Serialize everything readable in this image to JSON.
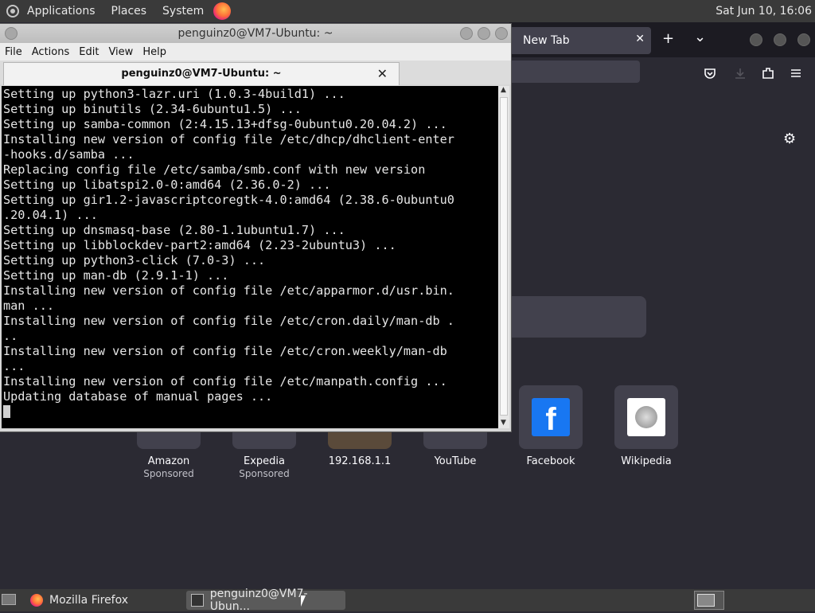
{
  "top_panel": {
    "menus": [
      "Applications",
      "Places",
      "System"
    ],
    "clock": "Sat Jun 10, 16:06"
  },
  "firefox": {
    "tab_label": "New Tab",
    "tab_close": "✕",
    "new_tab": "+",
    "tab_list": "⌄",
    "shortcuts": [
      {
        "title": "Amazon",
        "sub": "Sponsored"
      },
      {
        "title": "Expedia",
        "sub": "Sponsored"
      },
      {
        "title": "192.168.1.1",
        "sub": ""
      },
      {
        "title": "YouTube",
        "sub": ""
      },
      {
        "title": "Facebook",
        "sub": ""
      },
      {
        "title": "Wikipedia",
        "sub": ""
      }
    ]
  },
  "terminal": {
    "window_title": "penguinz0@VM7-Ubuntu: ~",
    "menu": [
      "File",
      "Actions",
      "Edit",
      "View",
      "Help"
    ],
    "tab_title": "penguinz0@VM7-Ubuntu: ~",
    "tab_close": "✕",
    "output": "Setting up python3-lazr.uri (1.0.3-4build1) ...\nSetting up binutils (2.34-6ubuntu1.5) ...\nSetting up samba-common (2:4.15.13+dfsg-0ubuntu0.20.04.2) ...\nInstalling new version of config file /etc/dhcp/dhclient-enter\n-hooks.d/samba ...\nReplacing config file /etc/samba/smb.conf with new version\nSetting up libatspi2.0-0:amd64 (2.36.0-2) ...\nSetting up gir1.2-javascriptcoregtk-4.0:amd64 (2.38.6-0ubuntu0\n.20.04.1) ...\nSetting up dnsmasq-base (2.80-1.1ubuntu1.7) ...\nSetting up libblockdev-part2:amd64 (2.23-2ubuntu3) ...\nSetting up python3-click (7.0-3) ...\nSetting up man-db (2.9.1-1) ...\nInstalling new version of config file /etc/apparmor.d/usr.bin.\nman ...\nInstalling new version of config file /etc/cron.daily/man-db .\n..\nInstalling new version of config file /etc/cron.weekly/man-db\n...\nInstalling new version of config file /etc/manpath.config ...\nUpdating database of manual pages ...\n"
  },
  "taskbar": {
    "items": [
      "Mozilla Firefox",
      "penguinz0@VM7-Ubun..."
    ]
  }
}
